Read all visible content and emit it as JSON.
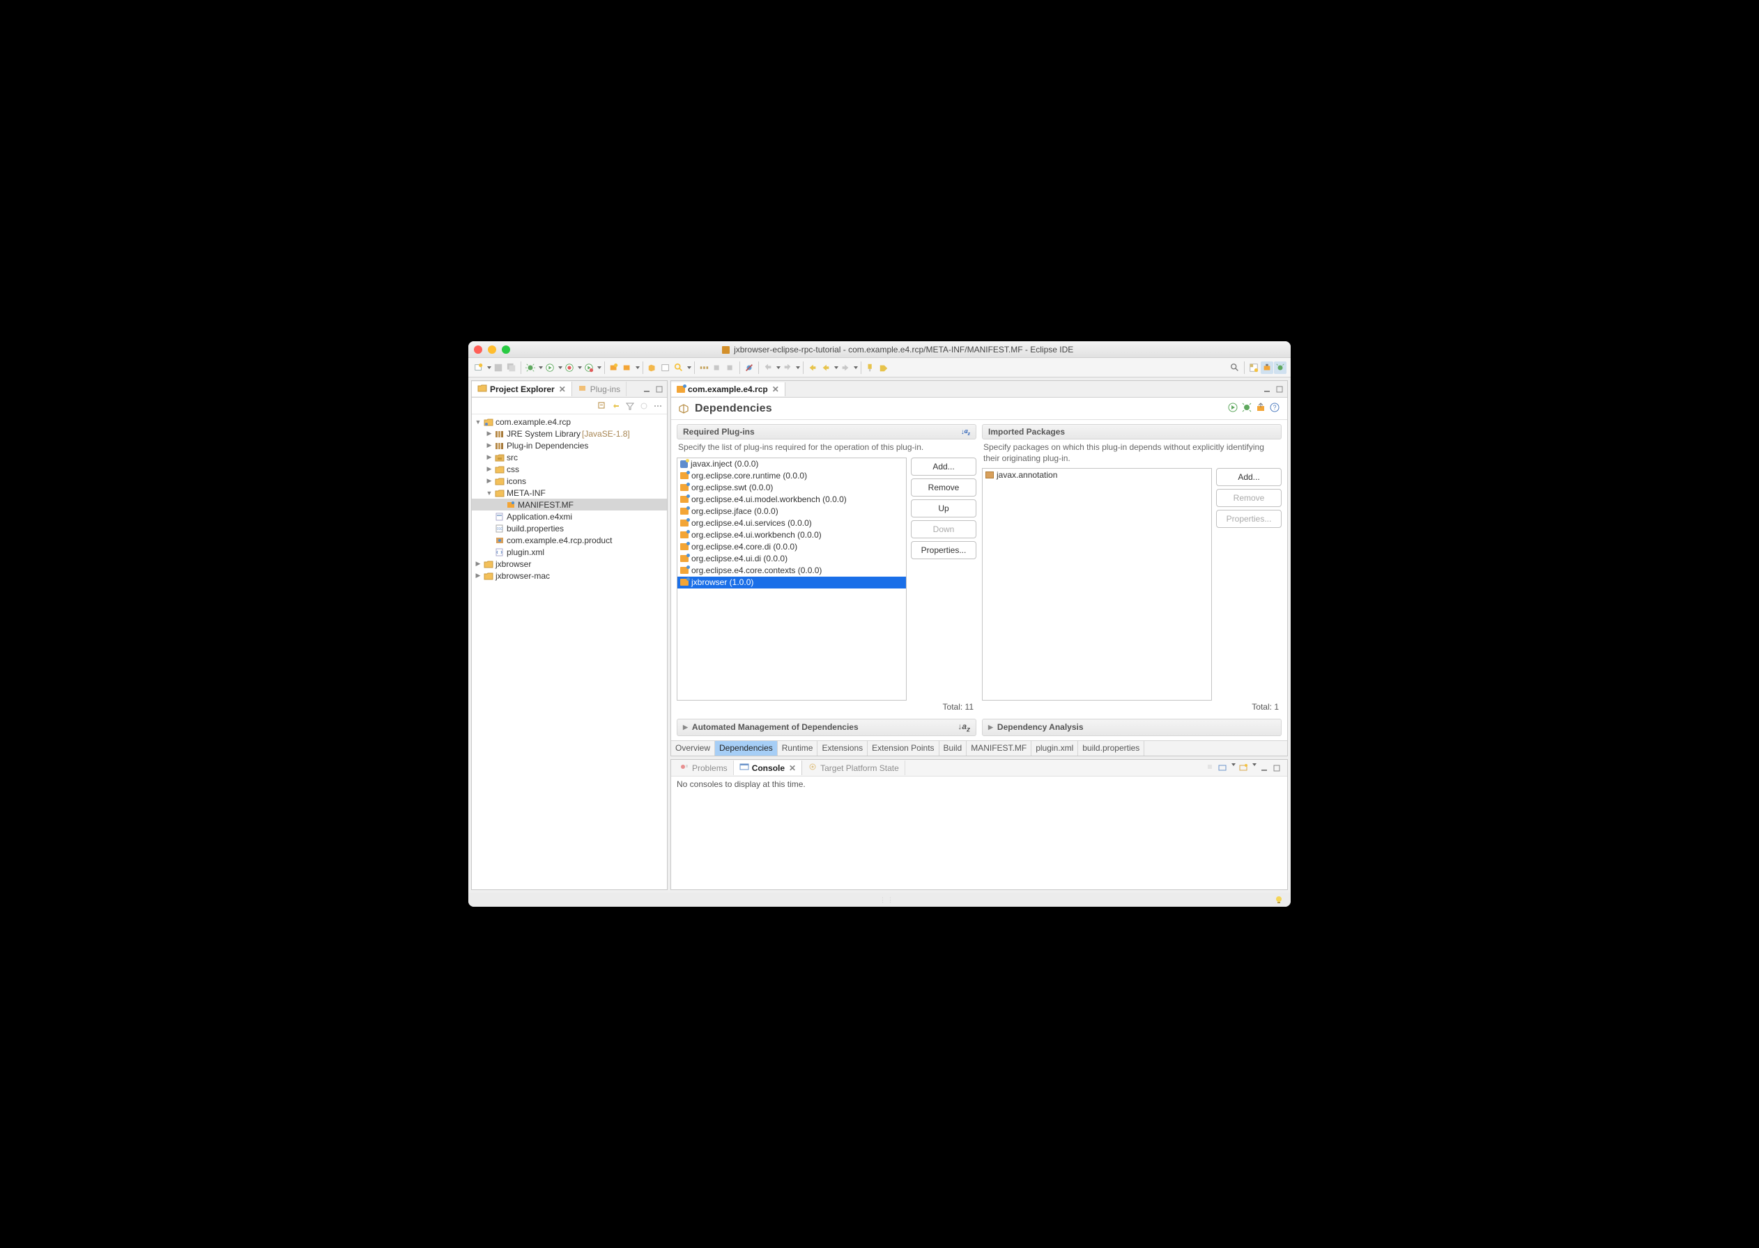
{
  "window": {
    "title": "jxbrowser-eclipse-rpc-tutorial - com.example.e4.rcp/META-INF/MANIFEST.MF - Eclipse IDE"
  },
  "leftPane": {
    "tabs": [
      {
        "label": "Project Explorer",
        "active": true
      },
      {
        "label": "Plug-ins",
        "active": false
      }
    ],
    "tree": [
      {
        "indent": 0,
        "expand": "down",
        "icon": "project",
        "label": "com.example.e4.rcp"
      },
      {
        "indent": 1,
        "expand": "right",
        "icon": "library",
        "label": "JRE System Library",
        "suffix": "[JavaSE-1.8]"
      },
      {
        "indent": 1,
        "expand": "right",
        "icon": "library",
        "label": "Plug-in Dependencies"
      },
      {
        "indent": 1,
        "expand": "right",
        "icon": "folder-src",
        "label": "src"
      },
      {
        "indent": 1,
        "expand": "right",
        "icon": "folder",
        "label": "css"
      },
      {
        "indent": 1,
        "expand": "right",
        "icon": "folder",
        "label": "icons"
      },
      {
        "indent": 1,
        "expand": "down",
        "icon": "folder",
        "label": "META-INF"
      },
      {
        "indent": 2,
        "expand": "",
        "icon": "manifest",
        "label": "MANIFEST.MF",
        "selected": true
      },
      {
        "indent": 1,
        "expand": "",
        "icon": "xmi",
        "label": "Application.e4xmi"
      },
      {
        "indent": 1,
        "expand": "",
        "icon": "props",
        "label": "build.properties"
      },
      {
        "indent": 1,
        "expand": "",
        "icon": "product",
        "label": "com.example.e4.rcp.product"
      },
      {
        "indent": 1,
        "expand": "",
        "icon": "xml",
        "label": "plugin.xml"
      },
      {
        "indent": 0,
        "expand": "right",
        "icon": "project-closed",
        "label": "jxbrowser"
      },
      {
        "indent": 0,
        "expand": "right",
        "icon": "project-closed",
        "label": "jxbrowser-mac"
      }
    ]
  },
  "editor": {
    "tabLabel": "com.example.e4.rcp",
    "pageTitle": "Dependencies",
    "required": {
      "title": "Required Plug-ins",
      "desc": "Specify the list of plug-ins required for the operation of this plug-in.",
      "items": [
        {
          "label": "javax.inject (0.0.0)",
          "icon": "inject"
        },
        {
          "label": "org.eclipse.core.runtime (0.0.0)",
          "icon": "plugin"
        },
        {
          "label": "org.eclipse.swt (0.0.0)",
          "icon": "plugin"
        },
        {
          "label": "org.eclipse.e4.ui.model.workbench (0.0.0)",
          "icon": "plugin"
        },
        {
          "label": "org.eclipse.jface (0.0.0)",
          "icon": "plugin"
        },
        {
          "label": "org.eclipse.e4.ui.services (0.0.0)",
          "icon": "plugin"
        },
        {
          "label": "org.eclipse.e4.ui.workbench (0.0.0)",
          "icon": "plugin"
        },
        {
          "label": "org.eclipse.e4.core.di (0.0.0)",
          "icon": "plugin"
        },
        {
          "label": "org.eclipse.e4.ui.di (0.0.0)",
          "icon": "plugin"
        },
        {
          "label": "org.eclipse.e4.core.contexts (0.0.0)",
          "icon": "plugin"
        },
        {
          "label": "jxbrowser (1.0.0)",
          "icon": "plugin",
          "selected": true
        }
      ],
      "buttons": {
        "add": "Add...",
        "remove": "Remove",
        "up": "Up",
        "down": "Down",
        "props": "Properties..."
      },
      "total": "Total: 11"
    },
    "imported": {
      "title": "Imported Packages",
      "desc": "Specify packages on which this plug-in depends without explicitly identifying their originating plug-in.",
      "items": [
        {
          "label": "javax.annotation",
          "icon": "package"
        }
      ],
      "buttons": {
        "add": "Add...",
        "remove": "Remove",
        "props": "Properties..."
      },
      "total": "Total: 1"
    },
    "collapsed": {
      "autoMgmt": "Automated Management of Dependencies",
      "depAnalysis": "Dependency Analysis"
    },
    "bottomTabs": [
      "Overview",
      "Dependencies",
      "Runtime",
      "Extensions",
      "Extension Points",
      "Build",
      "MANIFEST.MF",
      "plugin.xml",
      "build.properties"
    ],
    "activeBottomTab": 1
  },
  "console": {
    "tabs": [
      {
        "label": "Problems",
        "active": false
      },
      {
        "label": "Console",
        "active": true
      },
      {
        "label": "Target Platform State",
        "active": false
      }
    ],
    "empty": "No consoles to display at this time."
  }
}
